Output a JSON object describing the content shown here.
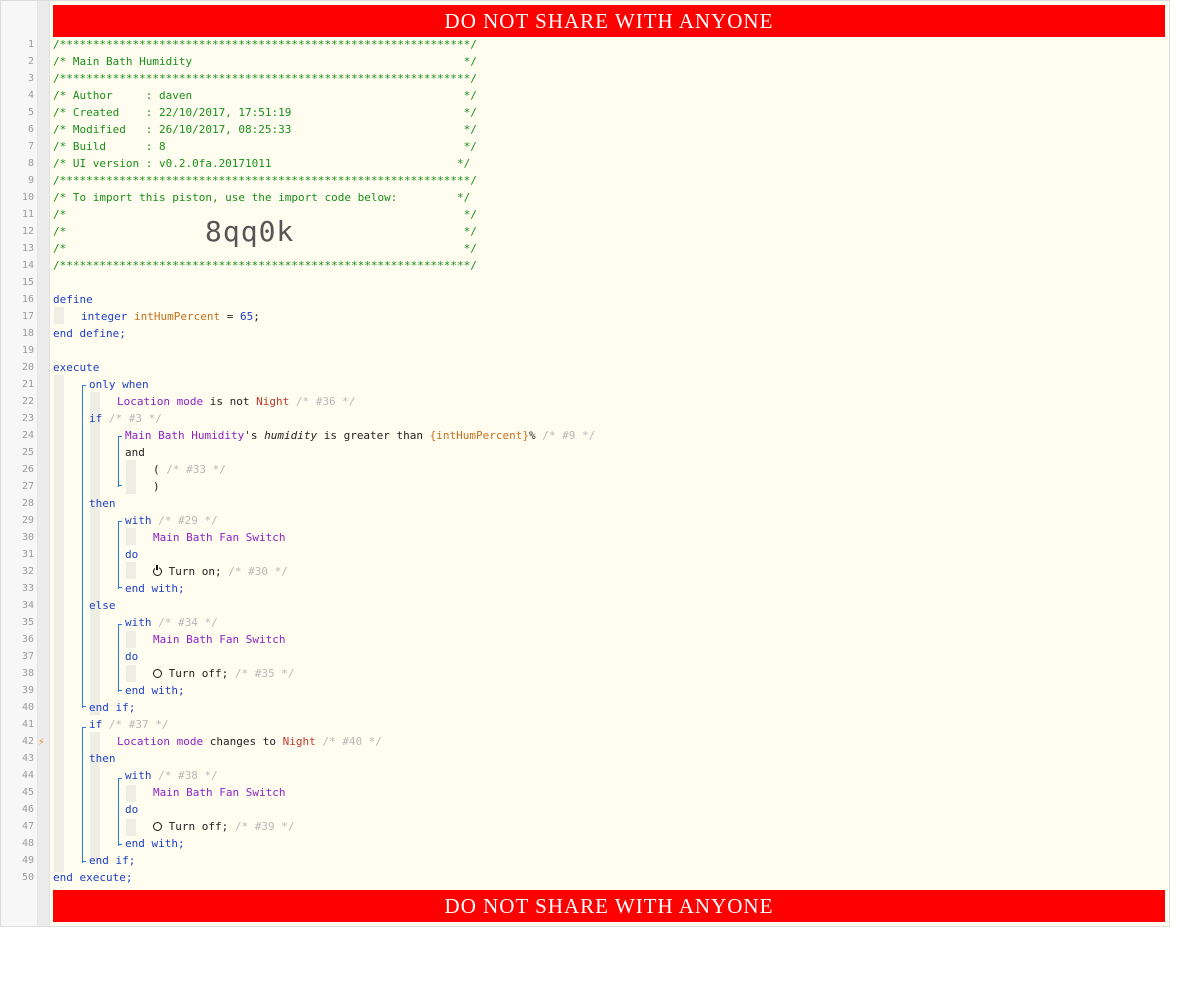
{
  "banner": {
    "top": "DO NOT SHARE WITH ANYONE",
    "bottom": "DO NOT SHARE WITH ANYONE"
  },
  "line_numbers": [
    "1",
    "2",
    "3",
    "4",
    "5",
    "6",
    "7",
    "8",
    "9",
    "10",
    "11",
    "12",
    "13",
    "14",
    "15",
    "16",
    "17",
    "18",
    "19",
    "20",
    "21",
    "22",
    "23",
    "24",
    "25",
    "26",
    "27",
    "28",
    "29",
    "30",
    "31",
    "32",
    "33",
    "34",
    "35",
    "36",
    "37",
    "38",
    "39",
    "40",
    "41",
    "42",
    "43",
    "44",
    "45",
    "46",
    "47",
    "48",
    "49",
    "50"
  ],
  "header": {
    "stars": "/**************************************************************/",
    "title": "/* Main Bath Humidity                                         */",
    "author": "/* Author     : daven                                         */",
    "created": "/* Created    : 22/10/2017, 17:51:19                          */",
    "modified": "/* Modified   : 26/10/2017, 08:25:33                          */",
    "build": "/* Build      : 8                                             */",
    "ui_version": "/* UI version : v0.2.0fa.20171011                            */",
    "import_note": "/* To import this piston, use the import code below:         */",
    "blank": "/*                                                            */",
    "import_code": "8qq0k"
  },
  "define": {
    "open": "define",
    "type": "integer",
    "var": "intHumPercent",
    "eq": " = ",
    "value": "65",
    "semi": ";",
    "close": "end define;"
  },
  "execute": {
    "open": "execute",
    "only_when": "only when",
    "loc_mode": "Location mode",
    "is_not": " is not ",
    "night": "Night",
    "c36": " /* #36 */",
    "if": "if",
    "c3": " /* #3 */",
    "dev_humidity": "Main Bath Humidity",
    "apos": "'s ",
    "humidity": "humidity",
    "greater": " is greater than ",
    "var_ref": "{intHumPercent}",
    "pct": "%",
    "c9": " /* #9 */",
    "and": "and",
    "paren_open": "(",
    "c33": " /* #33 */",
    "paren_close": ")",
    "then": "then",
    "with": "with",
    "c29": " /* #29 */",
    "fan": "Main Bath Fan Switch",
    "do": "do",
    "turn_on": " Turn on;",
    "c30": " /* #30 */",
    "end_with": "end with;",
    "else": "else",
    "c34": " /* #34 */",
    "turn_off": " Turn off;",
    "c35": " /* #35 */",
    "end_if": "end if;",
    "c37": " /* #37 */",
    "changes_to": " changes to ",
    "c40": " /* #40 */",
    "c38": " /* #38 */",
    "c39": " /* #39 */",
    "close": "end execute;"
  },
  "icons": {
    "trigger": "lightning-bolt-icon",
    "on": "power-on-icon",
    "off": "power-off-icon"
  },
  "colors": {
    "banner": "#ff0000",
    "keyword": "#1d3fc7",
    "device": "#8f22c9",
    "comment": "#1a8f1a",
    "value": "#c0392b",
    "block": "#2a7ed6",
    "editor_bg": "#fffdf0"
  }
}
